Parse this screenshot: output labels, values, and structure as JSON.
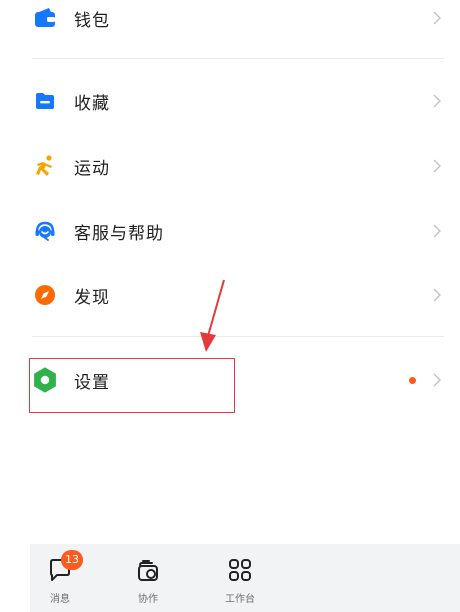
{
  "menu": {
    "wallet": "钱包",
    "favorites": "收藏",
    "sports": "运动",
    "support": "客服与帮助",
    "discover": "发现",
    "settings": "设置"
  },
  "bottom_nav": {
    "messages": "消息",
    "messages_badge": "13",
    "collaborate": "协作",
    "workbench": "工作台"
  },
  "colors": {
    "wallet_icon": "#1677ff",
    "favorites_icon": "#1677ff",
    "sports_icon": "#f5a400",
    "support_icon": "#1677ff",
    "discover_icon": "#ff6a00",
    "settings_icon": "#2fb24a",
    "badge": "#fa5c20",
    "annotation": "#e23b3b"
  }
}
